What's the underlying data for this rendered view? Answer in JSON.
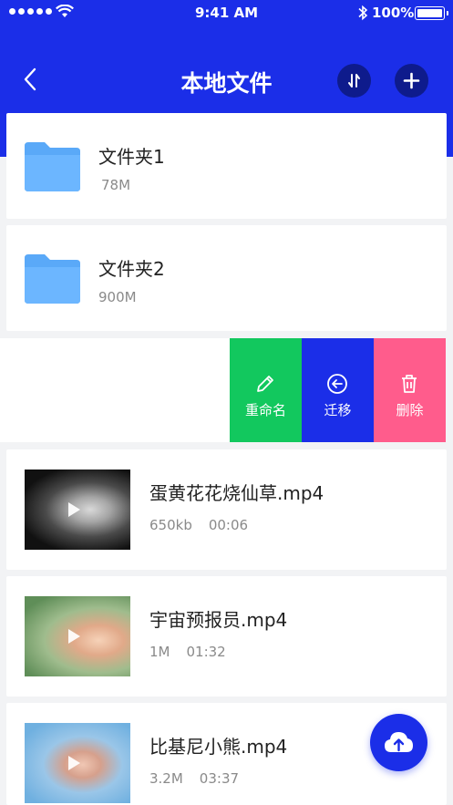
{
  "status_bar": {
    "time": "9:41 AM",
    "battery": "100%"
  },
  "nav": {
    "title": "本地文件",
    "back_icon": "chevron-left-icon",
    "sort_icon": "sort-arrows-icon",
    "add_icon": "plus-icon"
  },
  "folders": [
    {
      "name": "文件夹1",
      "size": "78M"
    },
    {
      "name": "文件夹2",
      "size": "900M"
    }
  ],
  "swipe_actions": [
    {
      "label": "重命名",
      "icon": "pencil-icon",
      "color": "#12c85e"
    },
    {
      "label": "迁移",
      "icon": "arrow-left-circle-icon",
      "color": "#1b2ee8"
    },
    {
      "label": "删除",
      "icon": "trash-icon",
      "color": "#ff5c8c"
    }
  ],
  "videos": [
    {
      "name": "蛋黄花花烧仙草.mp4",
      "size": "650kb",
      "duration": "00:06"
    },
    {
      "name": "宇宙预报员.mp4",
      "size": "1M",
      "duration": "01:32"
    },
    {
      "name": "比基尼小熊.mp4",
      "size": "3.2M",
      "duration": "03:37"
    }
  ],
  "upload_icon": "cloud-upload-icon",
  "colors": {
    "primary": "#1b2ee8",
    "rename": "#12c85e",
    "delete": "#ff5c8c",
    "folder": "#5aa9f8"
  }
}
